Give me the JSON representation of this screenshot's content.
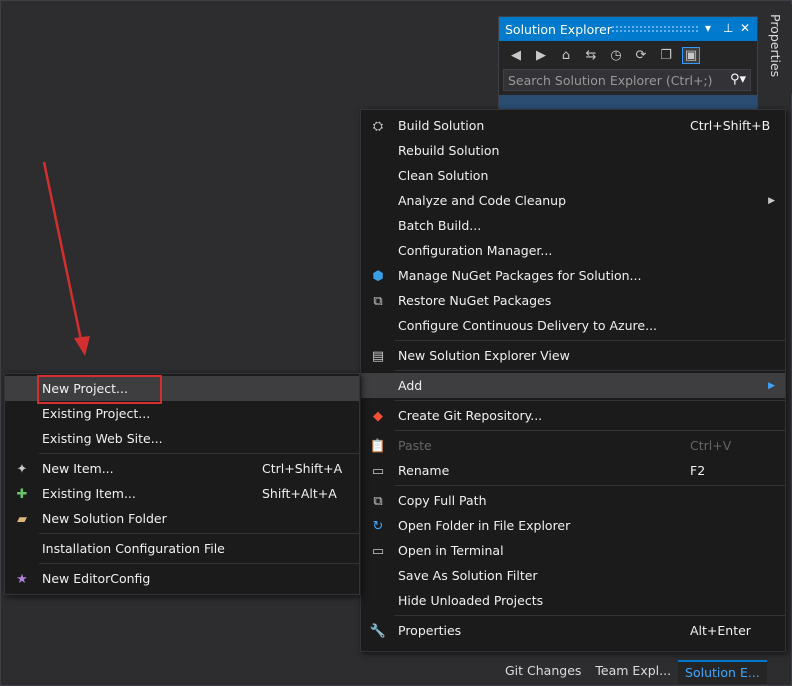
{
  "properties_tab": "Properties",
  "solution_explorer": {
    "title": "Solution Explorer",
    "search_placeholder": "Search Solution Explorer (Ctrl+;)",
    "tabs": [
      "Git Changes",
      "Team Expl...",
      "Solution E..."
    ]
  },
  "context_menu": {
    "build_solution": {
      "label": "Build Solution",
      "shortcut": "Ctrl+Shift+B"
    },
    "rebuild_solution": {
      "label": "Rebuild Solution"
    },
    "clean_solution": {
      "label": "Clean Solution"
    },
    "analyze": {
      "label": "Analyze and Code Cleanup"
    },
    "batch_build": {
      "label": "Batch Build..."
    },
    "config_manager": {
      "label": "Configuration Manager..."
    },
    "manage_nuget": {
      "label": "Manage NuGet Packages for Solution..."
    },
    "restore_nuget": {
      "label": "Restore NuGet Packages"
    },
    "configure_cd": {
      "label": "Configure Continuous Delivery to Azure..."
    },
    "new_se_view": {
      "label": "New Solution Explorer View"
    },
    "add": {
      "label": "Add"
    },
    "create_git": {
      "label": "Create Git Repository..."
    },
    "paste": {
      "label": "Paste",
      "shortcut": "Ctrl+V"
    },
    "rename": {
      "label": "Rename",
      "shortcut": "F2"
    },
    "copy_full_path": {
      "label": "Copy Full Path"
    },
    "open_folder": {
      "label": "Open Folder in File Explorer"
    },
    "open_terminal": {
      "label": "Open in Terminal"
    },
    "save_filter": {
      "label": "Save As Solution Filter"
    },
    "hide_unloaded": {
      "label": "Hide Unloaded Projects"
    },
    "properties": {
      "label": "Properties",
      "shortcut": "Alt+Enter"
    }
  },
  "add_submenu": {
    "new_project": {
      "label": "New Project..."
    },
    "existing_project": {
      "label": "Existing Project..."
    },
    "existing_web_site": {
      "label": "Existing Web Site..."
    },
    "new_item": {
      "label": "New Item...",
      "shortcut": "Ctrl+Shift+A"
    },
    "existing_item": {
      "label": "Existing Item...",
      "shortcut": "Shift+Alt+A"
    },
    "new_solution_folder": {
      "label": "New Solution Folder"
    },
    "install_config": {
      "label": "Installation Configuration File"
    },
    "new_editorconfig": {
      "label": "New EditorConfig"
    }
  },
  "colors": {
    "accent": "#007acc",
    "annotation": "#d32f2f"
  }
}
